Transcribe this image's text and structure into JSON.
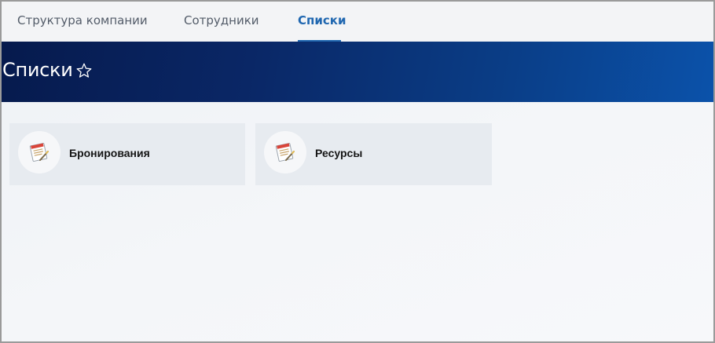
{
  "nav": {
    "tabs": [
      {
        "label": "Структура компании",
        "active": false
      },
      {
        "label": "Сотрудники",
        "active": false
      },
      {
        "label": "Списки",
        "active": true
      }
    ]
  },
  "header": {
    "title": "Списки",
    "favorite_icon": "star-outline-icon"
  },
  "lists": [
    {
      "label": "Бронирования",
      "icon": "list-document-icon"
    },
    {
      "label": "Ресурсы",
      "icon": "list-document-icon"
    }
  ],
  "colors": {
    "accent": "#2067b0",
    "banner_dark": "#061a4d",
    "banner_light": "#0b52aa",
    "tile_bg": "#e7ebf0"
  }
}
